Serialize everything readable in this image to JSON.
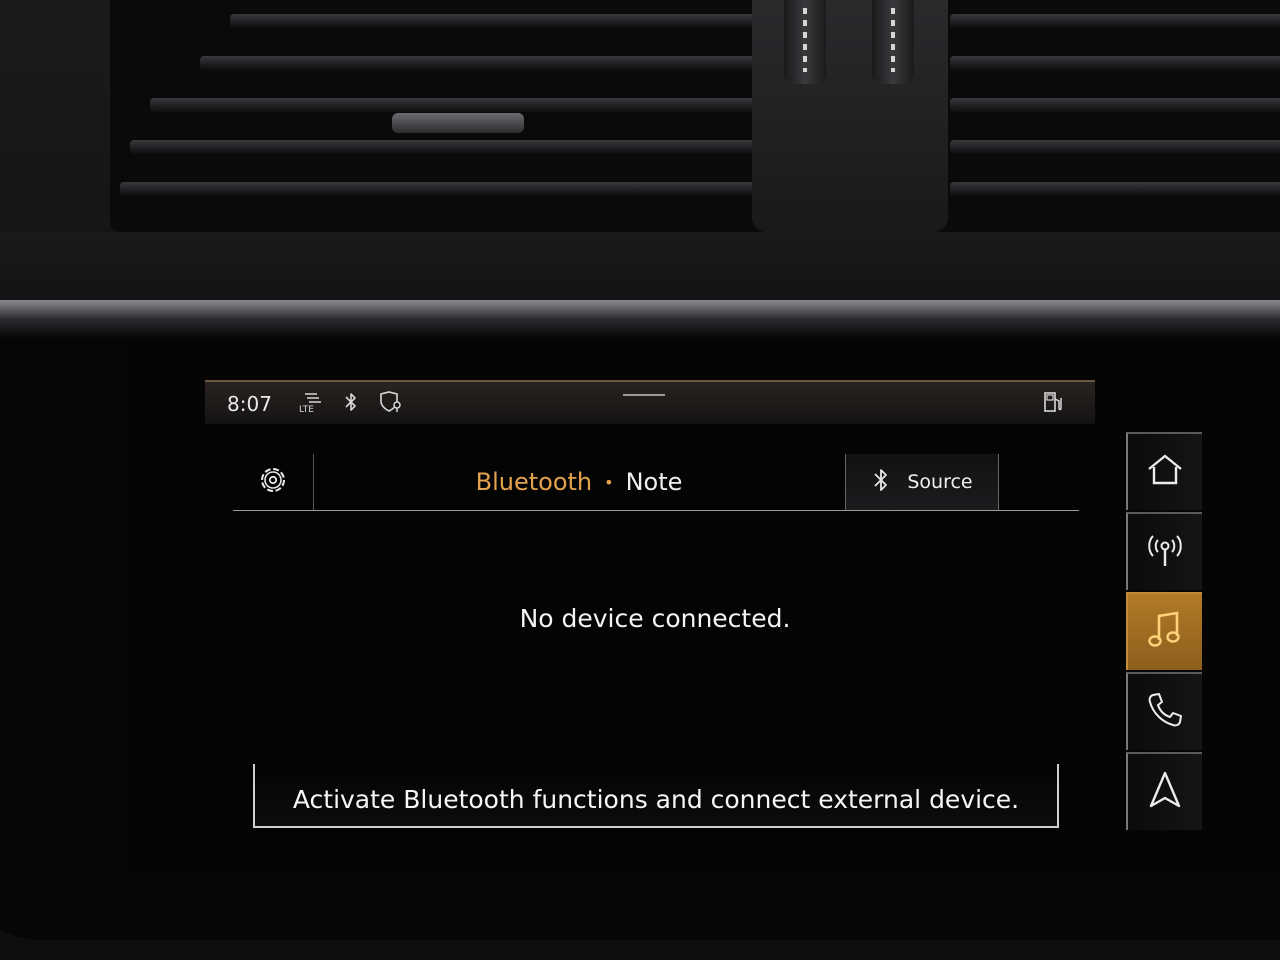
{
  "statusbar": {
    "time": "8:07",
    "icons": [
      "lte-signal-icon",
      "bluetooth-icon",
      "navigation-shield-icon",
      "fuel-pump-icon"
    ]
  },
  "header": {
    "title_active": "Bluetooth",
    "separator": "•",
    "title_secondary": "Note",
    "source_label": "Source"
  },
  "main": {
    "message": "No device connected.",
    "action_label": "Activate Bluetooth functions and connect external device."
  },
  "sidenav": {
    "items": [
      "home-icon",
      "radio-icon",
      "music-icon",
      "phone-icon",
      "navigation-arrow-icon"
    ],
    "active": "music-icon"
  },
  "colors": {
    "accent": "#e3a24e",
    "active_nav": "#9c6a20",
    "text": "#f2f2f2",
    "background": "#040405"
  }
}
